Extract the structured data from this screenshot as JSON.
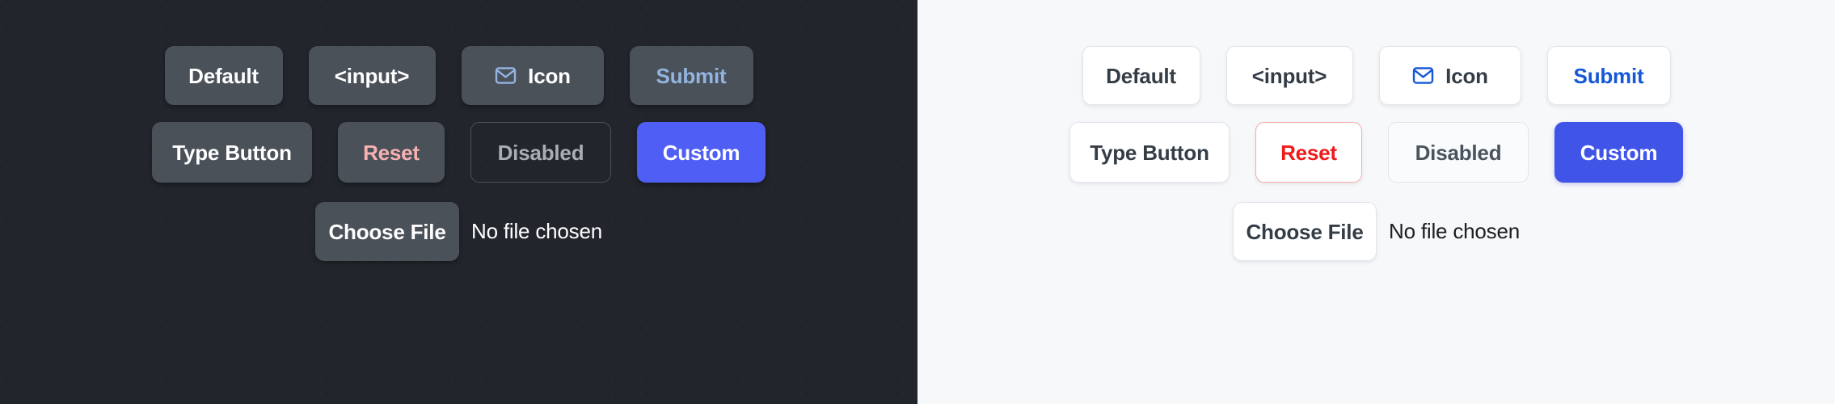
{
  "panels": [
    {
      "theme": "dark",
      "background": "#22262c",
      "row1": [
        {
          "label": "Default",
          "name": "default-button"
        },
        {
          "label": "<input>",
          "name": "input-button"
        },
        {
          "label": "Icon",
          "name": "icon-button",
          "icon": "mail-icon"
        },
        {
          "label": "Submit",
          "name": "submit-button",
          "color": "#93b4e0"
        }
      ],
      "row2": [
        {
          "label": "Type Button",
          "name": "type-button"
        },
        {
          "label": "Reset",
          "name": "reset-button",
          "color": "#f7b1b1"
        },
        {
          "label": "Disabled",
          "name": "disabled-button",
          "color": "#a9aeb4"
        },
        {
          "label": "Custom",
          "name": "custom-button",
          "background": "#4f5ef5",
          "color": "#ffffff"
        }
      ],
      "file": {
        "button_label": "Choose File",
        "status_text": "No file chosen"
      }
    },
    {
      "theme": "light",
      "background": "#f7f8fa",
      "row1": [
        {
          "label": "Default",
          "name": "default-button"
        },
        {
          "label": "<input>",
          "name": "input-button"
        },
        {
          "label": "Icon",
          "name": "icon-button",
          "icon": "mail-icon"
        },
        {
          "label": "Submit",
          "name": "submit-button",
          "color": "#1558d6"
        }
      ],
      "row2": [
        {
          "label": "Type Button",
          "name": "type-button"
        },
        {
          "label": "Reset",
          "name": "reset-button",
          "color": "#f01a1a",
          "border": "#f7abab"
        },
        {
          "label": "Disabled",
          "name": "disabled-button",
          "color": "#4a545e"
        },
        {
          "label": "Custom",
          "name": "custom-button",
          "background": "#4054e8",
          "color": "#ffffff"
        }
      ],
      "file": {
        "button_label": "Choose File",
        "status_text": "No file chosen"
      }
    }
  ]
}
